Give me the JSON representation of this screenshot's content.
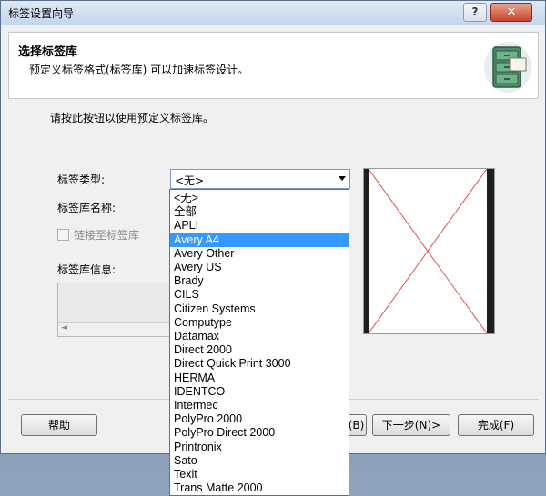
{
  "window": {
    "title": "标签设置向导",
    "help_label": "?",
    "close_label": "✕"
  },
  "header": {
    "title": "选择标签库",
    "description": "预定义标签格式(标签库) 可以加速标签设计。"
  },
  "instruction": "请按此按钮以使用预定义标签库。",
  "form": {
    "type_label": "标签类型:",
    "type_value": "<无>",
    "library_name_label": "标签库名称:",
    "link_label": "链接至标签库",
    "info_label": "标签库信息:"
  },
  "dropdown": {
    "options": [
      "<无>",
      "全部",
      "APLI",
      "Avery A4",
      "Avery Other",
      "Avery US",
      "Brady",
      "CILS",
      "Citizen Systems",
      "Computype",
      "Datamax",
      "Direct 2000",
      "Direct Quick Print 3000",
      "HERMA",
      "IDENTCO",
      "Intermec",
      "PolyPro 2000",
      "PolyPro Direct 2000",
      "Printronix",
      "Sato",
      "Texit",
      "Trans Matte 2000"
    ],
    "selected_index": 3
  },
  "buttons": {
    "help": "帮助",
    "back_partial": "(B)",
    "next": "下一步(N)>",
    "finish": "完成(F)"
  },
  "colors": {
    "selection": "#3399ff",
    "preview_cross": "#e05050"
  }
}
